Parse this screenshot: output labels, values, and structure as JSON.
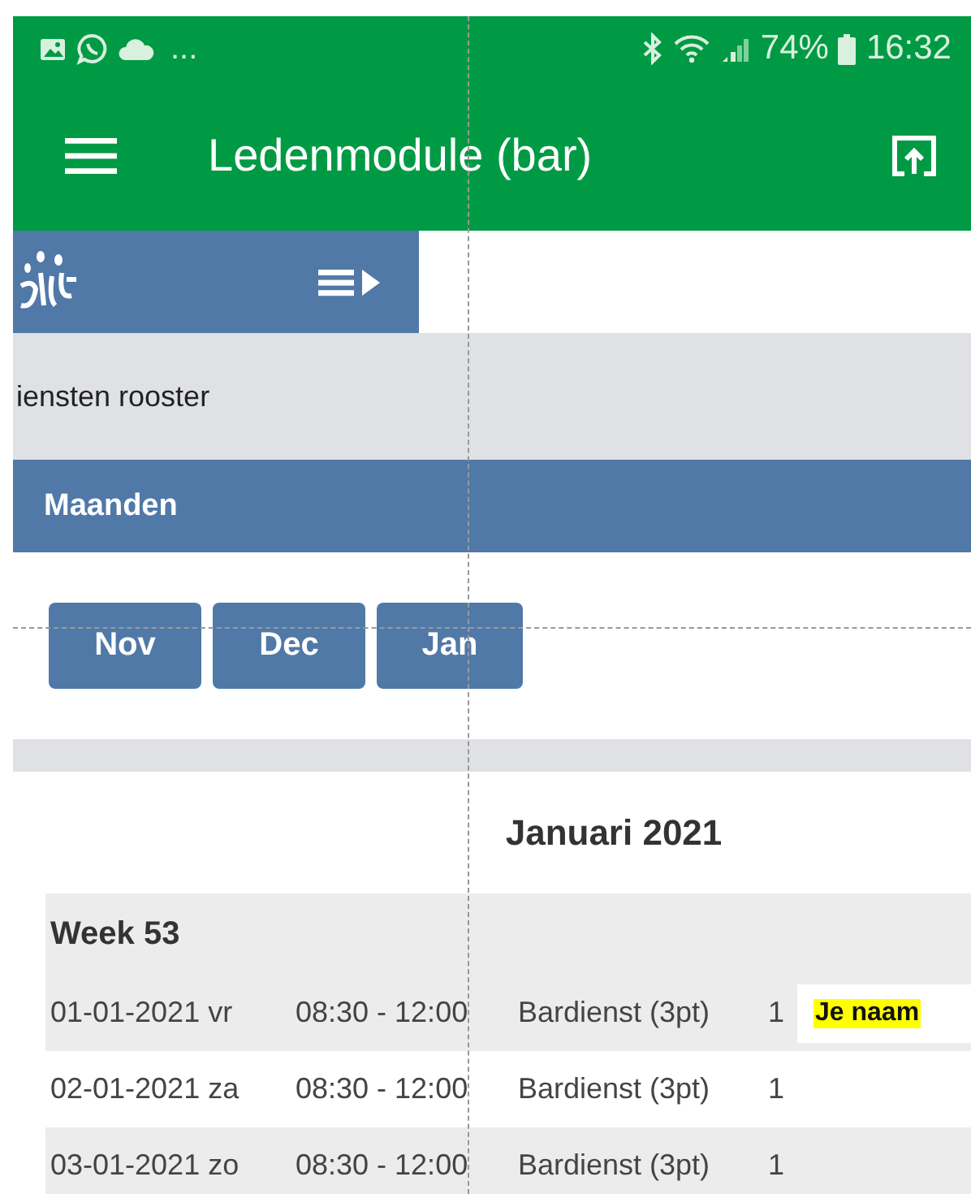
{
  "status_bar": {
    "more": "...",
    "battery": "74%",
    "time": "16:32"
  },
  "app_bar": {
    "title": "Ledenmodule (bar)"
  },
  "section_title": "iensten rooster",
  "panel": {
    "title": "Maanden"
  },
  "months": [
    {
      "label": "Nov"
    },
    {
      "label": "Dec"
    },
    {
      "label": "Jan"
    }
  ],
  "month_title": "Januari 2021",
  "weeks": [
    {
      "title": "Week 53",
      "rows": [
        {
          "date": "01-01-2021 vr",
          "time": "08:30 - 12:00",
          "service": "Bardienst (3pt)",
          "count": "1",
          "name": "Je naam"
        },
        {
          "date": "02-01-2021 za",
          "time": "08:30 - 12:00",
          "service": "Bardienst (3pt)",
          "count": "1"
        },
        {
          "date": "03-01-2021 zo",
          "time": "08:30 - 12:00",
          "service": "Bardienst (3pt)",
          "count": "1"
        }
      ]
    }
  ]
}
